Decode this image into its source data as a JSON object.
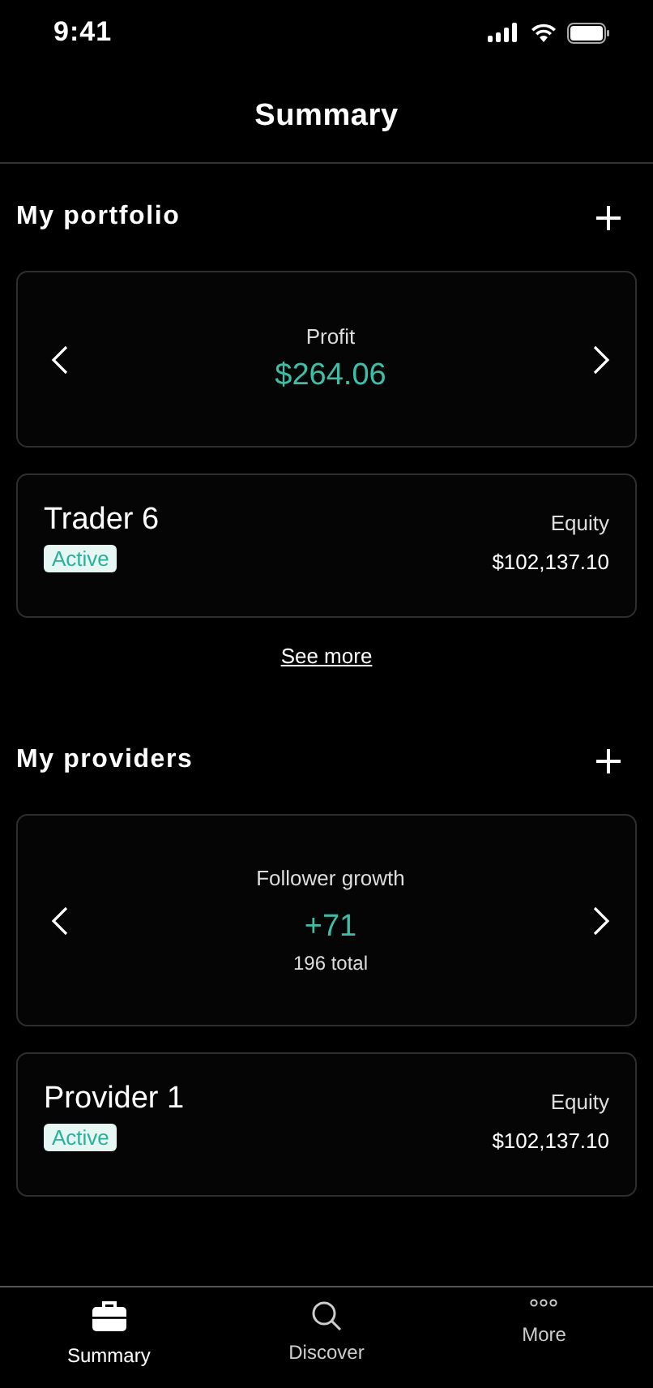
{
  "status_bar": {
    "time": "9:41"
  },
  "header": {
    "title": "Summary"
  },
  "sections": [
    {
      "title": "My portfolio",
      "carousel": {
        "label": "Profit",
        "value": "$264.06"
      },
      "accounts": [
        {
          "name": "Trader 6",
          "status": "Active",
          "equity_label": "Equity",
          "equity": "$102,137.10"
        }
      ],
      "link": "See more"
    },
    {
      "title": "My providers",
      "carousel": {
        "label": "Follower growth",
        "value": "+71",
        "subtext": "196 total"
      },
      "accounts": [
        {
          "name": "Provider 1",
          "status": "Active",
          "equity_label": "Equity",
          "equity": "$102,137.10"
        }
      ]
    }
  ],
  "tabs": [
    {
      "kind": "briefcase",
      "label": "Summary",
      "selected": true
    },
    {
      "kind": "search",
      "label": "Discover",
      "selected": false
    },
    {
      "kind": "more",
      "label": "More",
      "selected": false
    }
  ]
}
